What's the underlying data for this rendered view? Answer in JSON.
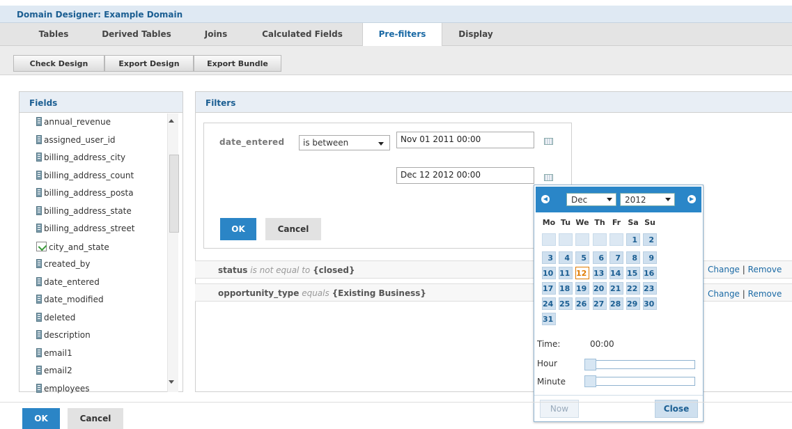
{
  "window": {
    "title": "Domain Designer: Example Domain"
  },
  "tabs": [
    "Tables",
    "Derived Tables",
    "Joins",
    "Calculated Fields",
    "Pre-filters",
    "Display"
  ],
  "active_tab": "Pre-filters",
  "toolbar": {
    "check": "Check Design",
    "export": "Export Design",
    "bundle": "Export Bundle"
  },
  "fields_panel": {
    "title": "Fields",
    "items": [
      "annual_revenue",
      "assigned_user_id",
      "billing_address_city",
      "billing_address_count",
      "billing_address_posta",
      "billing_address_state",
      "billing_address_street",
      "city_and_state",
      "created_by",
      "date_entered",
      "date_modified",
      "deleted",
      "description",
      "email1",
      "email2",
      "employees"
    ]
  },
  "filters_panel": {
    "title": "Filters",
    "editor": {
      "field": "date_entered",
      "operator": "is between",
      "from": "Nov 01 2011 00:00",
      "to": "Dec 12 2012 00:00",
      "ok": "OK",
      "cancel": "Cancel"
    },
    "rows": [
      {
        "field": "status",
        "op": "is not equal to",
        "value": "{closed}"
      },
      {
        "field": "opportunity_type",
        "op": "equals",
        "value": "{Existing Business}"
      }
    ],
    "change": "Change",
    "sep": "|",
    "remove": "Remove"
  },
  "calendar": {
    "month": "Dec",
    "year": "2012",
    "dow": [
      "Mo",
      "Tu",
      "We",
      "Th",
      "Fr",
      "Sa",
      "Su"
    ],
    "days": [
      "1",
      "2",
      "3",
      "4",
      "5",
      "6",
      "7",
      "8",
      "9",
      "10",
      "11",
      "12",
      "13",
      "14",
      "15",
      "16",
      "17",
      "18",
      "19",
      "20",
      "21",
      "22",
      "23",
      "24",
      "25",
      "26",
      "27",
      "28",
      "29",
      "30",
      "31"
    ],
    "selected_day": "12",
    "time_label": "Time:",
    "time_value": "00:00",
    "hour_label": "Hour",
    "minute_label": "Minute",
    "now": "Now",
    "close": "Close",
    "hour_level": 0,
    "minute_level": 0
  },
  "footer": {
    "ok": "OK",
    "cancel": "Cancel"
  },
  "colors": {
    "accent": "#2b85c6",
    "today": "#e07b00",
    "link": "#1b6aa5"
  }
}
